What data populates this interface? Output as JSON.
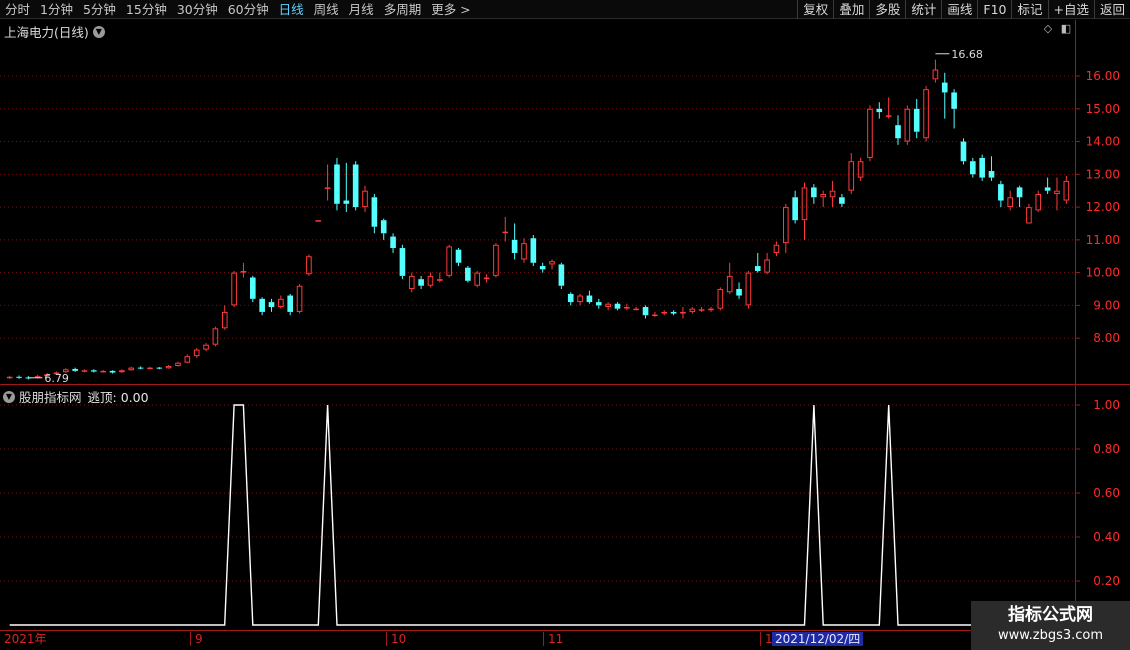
{
  "toolbar": {
    "periods": [
      "分时",
      "1分钟",
      "5分钟",
      "15分钟",
      "30分钟",
      "60分钟",
      "日线",
      "周线",
      "月线",
      "多周期",
      "更多 >"
    ],
    "active_period": "日线",
    "tools": [
      "复权",
      "叠加",
      "多股",
      "统计",
      "画线",
      "F10",
      "标记",
      "+自选",
      "返回"
    ]
  },
  "stock_title": "上海电力(日线)",
  "indicator": {
    "name": "股朋指标网",
    "label": "逃顶: 0.00"
  },
  "date_axis": {
    "labels": [
      "2021年",
      "9",
      "10",
      "11",
      "1"
    ],
    "cursor_date": "2021/12/02/四"
  },
  "watermark": {
    "line1": "指标公式网",
    "line2": "www.zbgs3.com"
  },
  "colors": {
    "up": "#ff3a3a",
    "down": "#54ffff",
    "grid": "#7a1010",
    "axis_label": "#ff2a2a"
  },
  "chart_data": [
    {
      "type": "candlestick",
      "title": "上海电力(日线)",
      "y_ticks": [
        8.0,
        9.0,
        10.0,
        11.0,
        12.0,
        13.0,
        14.0,
        15.0,
        16.0
      ],
      "y_tick_labels": [
        "8.00",
        "9.00",
        "10.00",
        "11.00",
        "12.00",
        "13.00",
        "14.00",
        "15.00",
        "16.00"
      ],
      "ylim": [
        6.6,
        17.1
      ],
      "annotations": [
        {
          "text": "16.68",
          "value": 16.68
        },
        {
          "text": "6.79",
          "value": 6.79
        }
      ],
      "candles": [
        [
          6.8,
          6.82,
          6.85,
          6.76
        ],
        [
          6.82,
          6.8,
          6.86,
          6.76
        ],
        [
          6.8,
          6.78,
          6.84,
          6.74
        ],
        [
          6.79,
          6.84,
          6.88,
          6.76
        ],
        [
          6.84,
          6.9,
          6.93,
          6.82
        ],
        [
          6.9,
          6.95,
          6.98,
          6.88
        ],
        [
          6.96,
          7.05,
          7.08,
          6.94
        ],
        [
          7.06,
          7.0,
          7.1,
          6.97
        ],
        [
          7.0,
          7.02,
          7.05,
          6.96
        ],
        [
          7.02,
          6.98,
          7.05,
          6.95
        ],
        [
          6.98,
          7.0,
          7.03,
          6.95
        ],
        [
          7.0,
          6.95,
          7.02,
          6.92
        ],
        [
          6.96,
          7.02,
          7.05,
          6.94
        ],
        [
          7.02,
          7.1,
          7.13,
          7.0
        ],
        [
          7.1,
          7.08,
          7.14,
          7.05
        ],
        [
          7.08,
          7.1,
          7.13,
          7.05
        ],
        [
          7.1,
          7.08,
          7.12,
          7.05
        ],
        [
          7.08,
          7.15,
          7.18,
          7.06
        ],
        [
          7.15,
          7.25,
          7.28,
          7.13
        ],
        [
          7.25,
          7.45,
          7.5,
          7.23
        ],
        [
          7.45,
          7.65,
          7.7,
          7.4
        ],
        [
          7.65,
          7.8,
          7.85,
          7.6
        ],
        [
          7.8,
          8.3,
          8.35,
          7.75
        ],
        [
          8.3,
          8.8,
          9.0,
          8.25
        ],
        [
          9.0,
          10.0,
          10.05,
          8.95
        ],
        [
          10.0,
          10.05,
          10.3,
          9.85
        ],
        [
          9.85,
          9.2,
          9.9,
          9.1
        ],
        [
          9.2,
          8.8,
          9.25,
          8.7
        ],
        [
          9.1,
          8.95,
          9.2,
          8.8
        ],
        [
          8.95,
          9.2,
          9.3,
          8.9
        ],
        [
          9.3,
          8.8,
          9.35,
          8.7
        ],
        [
          8.8,
          9.6,
          9.65,
          8.75
        ],
        [
          9.95,
          10.5,
          10.55,
          9.9
        ],
        [
          11.6,
          11.6,
          11.6,
          11.6
        ],
        [
          12.6,
          12.6,
          13.3,
          12.2
        ],
        [
          13.3,
          12.1,
          13.5,
          11.9
        ],
        [
          12.2,
          12.1,
          13.35,
          11.85
        ],
        [
          13.3,
          12.0,
          13.4,
          11.9
        ],
        [
          12.0,
          12.5,
          12.65,
          11.85
        ],
        [
          12.3,
          11.4,
          12.4,
          11.2
        ],
        [
          11.6,
          11.2,
          11.65,
          11.0
        ],
        [
          11.1,
          10.75,
          11.2,
          10.6
        ],
        [
          10.75,
          9.9,
          10.85,
          9.8
        ],
        [
          9.5,
          9.9,
          10.0,
          9.4
        ],
        [
          9.8,
          9.6,
          9.9,
          9.5
        ],
        [
          9.6,
          9.9,
          10.0,
          9.55
        ],
        [
          9.75,
          9.8,
          10.0,
          9.7
        ],
        [
          9.9,
          10.8,
          10.85,
          9.85
        ],
        [
          10.7,
          10.3,
          10.75,
          10.2
        ],
        [
          10.15,
          9.75,
          10.2,
          9.7
        ],
        [
          9.6,
          10.0,
          10.05,
          9.55
        ],
        [
          9.8,
          9.85,
          9.95,
          9.7
        ],
        [
          9.9,
          10.85,
          10.9,
          9.85
        ],
        [
          11.25,
          11.25,
          11.7,
          10.95
        ],
        [
          11.0,
          10.6,
          11.5,
          10.4
        ],
        [
          10.4,
          10.9,
          11.05,
          10.3
        ],
        [
          11.05,
          10.3,
          11.15,
          10.2
        ],
        [
          10.2,
          10.1,
          10.3,
          10.0
        ],
        [
          10.25,
          10.35,
          10.4,
          10.1
        ],
        [
          10.25,
          9.6,
          10.3,
          9.5
        ],
        [
          9.35,
          9.1,
          9.4,
          9.0
        ],
        [
          9.1,
          9.3,
          9.35,
          9.0
        ],
        [
          9.3,
          9.1,
          9.45,
          9.05
        ],
        [
          9.1,
          9.0,
          9.2,
          8.9
        ],
        [
          8.95,
          9.05,
          9.1,
          8.85
        ],
        [
          9.05,
          8.9,
          9.1,
          8.85
        ],
        [
          8.95,
          8.95,
          9.05,
          8.85
        ],
        [
          8.9,
          8.9,
          8.95,
          8.85
        ],
        [
          8.95,
          8.7,
          9.0,
          8.6
        ],
        [
          8.7,
          8.72,
          8.8,
          8.65
        ],
        [
          8.75,
          8.8,
          8.85,
          8.7
        ],
        [
          8.8,
          8.75,
          8.85,
          8.7
        ],
        [
          8.75,
          8.8,
          8.95,
          8.6
        ],
        [
          8.8,
          8.9,
          8.95,
          8.75
        ],
        [
          8.85,
          8.88,
          8.95,
          8.8
        ],
        [
          8.85,
          8.9,
          8.95,
          8.8
        ],
        [
          8.9,
          9.5,
          9.55,
          8.85
        ],
        [
          9.4,
          9.9,
          10.3,
          9.35
        ],
        [
          9.5,
          9.3,
          9.7,
          9.2
        ],
        [
          9.0,
          10.0,
          10.05,
          8.9
        ],
        [
          10.2,
          10.05,
          10.6,
          10.0
        ],
        [
          10.0,
          10.4,
          10.6,
          9.95
        ],
        [
          10.6,
          10.85,
          10.95,
          10.5
        ],
        [
          10.9,
          12.0,
          12.1,
          10.6
        ],
        [
          12.3,
          11.6,
          12.5,
          11.5
        ],
        [
          11.6,
          12.6,
          12.75,
          11.0
        ],
        [
          12.6,
          12.3,
          12.7,
          12.1
        ],
        [
          12.3,
          12.4,
          12.5,
          12.0
        ],
        [
          12.3,
          12.5,
          12.8,
          12.0
        ],
        [
          12.3,
          12.1,
          12.4,
          12.0
        ],
        [
          12.5,
          13.4,
          13.65,
          12.4
        ],
        [
          12.9,
          13.4,
          13.5,
          12.8
        ],
        [
          13.5,
          15.0,
          15.1,
          13.4
        ],
        [
          15.0,
          14.9,
          15.2,
          14.7
        ],
        [
          14.8,
          14.8,
          15.35,
          14.7
        ],
        [
          14.5,
          14.1,
          14.8,
          13.9
        ],
        [
          14.0,
          15.0,
          15.1,
          13.9
        ],
        [
          15.0,
          14.3,
          15.3,
          14.1
        ],
        [
          14.1,
          15.6,
          15.7,
          14.0
        ],
        [
          15.9,
          16.2,
          16.5,
          15.8
        ],
        [
          15.8,
          15.5,
          16.1,
          14.7
        ],
        [
          15.5,
          15.0,
          15.6,
          14.4
        ],
        [
          14.0,
          13.4,
          14.1,
          13.3
        ],
        [
          13.4,
          13.0,
          13.5,
          12.9
        ],
        [
          13.5,
          12.9,
          13.6,
          12.8
        ],
        [
          13.1,
          12.9,
          13.55,
          12.8
        ],
        [
          12.7,
          12.2,
          12.8,
          12.0
        ],
        [
          12.0,
          12.3,
          12.5,
          11.9
        ],
        [
          12.6,
          12.3,
          12.65,
          12.0
        ],
        [
          11.5,
          12.0,
          12.1,
          11.5
        ],
        [
          11.9,
          12.4,
          12.5,
          11.85
        ],
        [
          12.6,
          12.5,
          12.9,
          12.4
        ],
        [
          12.4,
          12.5,
          12.9,
          11.9
        ],
        [
          12.2,
          12.8,
          12.95,
          12.1
        ]
      ]
    },
    {
      "type": "line",
      "title": "股朋指标网",
      "series": [
        {
          "values": [
            0,
            0,
            0,
            0,
            0,
            0,
            0,
            0,
            0,
            0,
            0,
            0,
            0,
            0,
            0,
            0,
            0,
            0,
            0,
            0,
            0,
            0,
            0,
            0,
            1,
            1,
            0,
            0,
            0,
            0,
            0,
            0,
            0,
            0,
            1,
            0,
            0,
            0,
            0,
            0,
            0,
            0,
            0,
            0,
            0,
            0,
            0,
            0,
            0,
            0,
            0,
            0,
            0,
            0,
            0,
            0,
            0,
            0,
            0,
            0,
            0,
            0,
            0,
            0,
            0,
            0,
            0,
            0,
            0,
            0,
            0,
            0,
            0,
            0,
            0,
            0,
            0,
            0,
            0,
            0,
            0,
            0,
            0,
            0,
            0,
            0,
            1,
            0,
            0,
            0,
            0,
            0,
            0,
            0,
            1,
            0,
            0,
            0,
            0,
            0,
            0,
            0,
            0,
            0,
            0,
            0,
            0,
            0,
            0,
            0,
            0,
            0,
            0,
            0,
            0,
            0,
            0
          ]
        }
      ],
      "y_ticks": [
        0.2,
        0.4,
        0.6,
        0.8,
        1.0
      ],
      "y_tick_labels": [
        "0.20",
        "0.40",
        "0.60",
        "0.80",
        "1.00"
      ],
      "ylim": [
        0,
        1.0
      ]
    }
  ]
}
